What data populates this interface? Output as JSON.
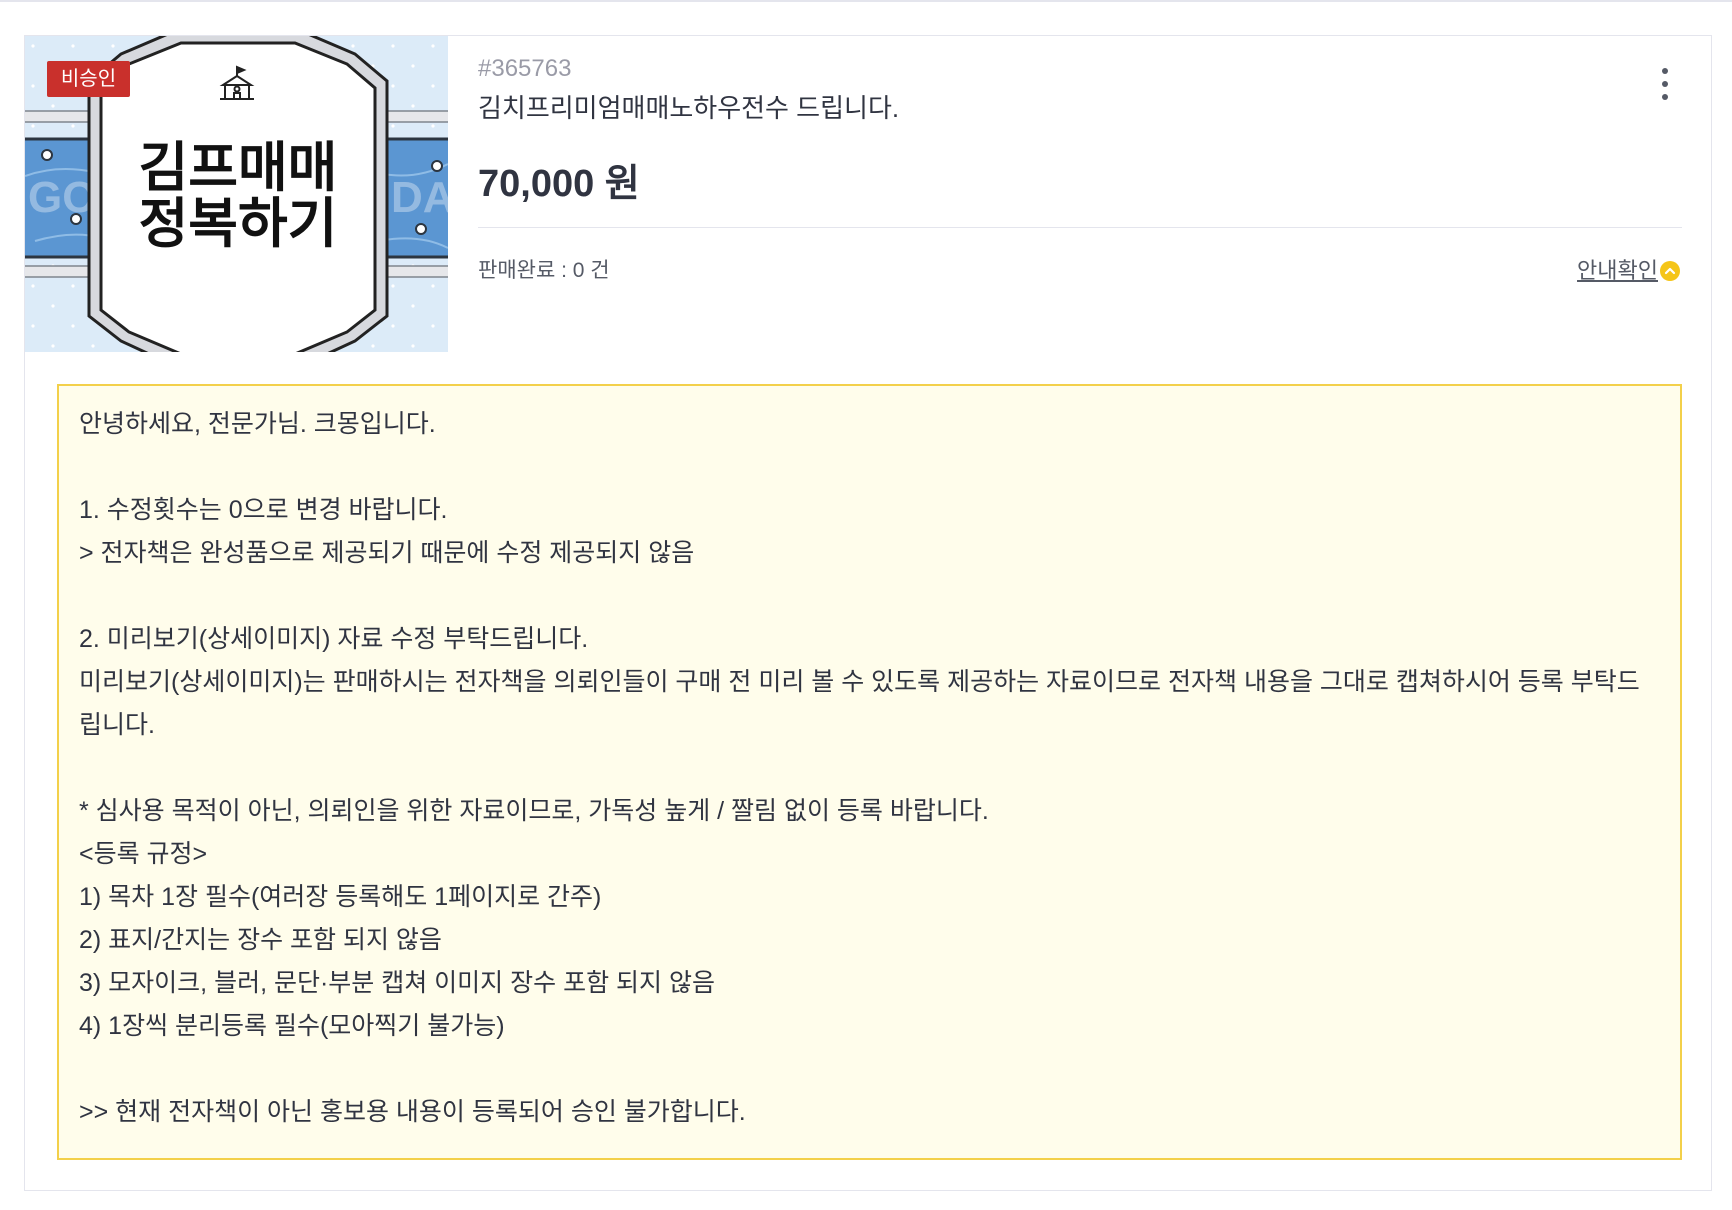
{
  "status_badge": "비승인",
  "thumbnail": {
    "headline_line1": "김프매매",
    "headline_line2": "정복하기",
    "bg_text_left": "GO",
    "bg_text_right": "DA",
    "icon": "school-icon",
    "colors": {
      "background": "#dcebf8",
      "band": "#5b96d2",
      "frame": "#d7d9de"
    }
  },
  "service": {
    "id": "#365763",
    "title": "김치프리미엄매매노하우전수 드립니다.",
    "price": "70,000 원",
    "sales_count": "판매완료 : 0 건",
    "guide_link": "안내확인",
    "guide_icon": "chevron-up-icon",
    "menu_icon": "more-vertical-icon"
  },
  "notice": {
    "paragraphs": [
      [
        "안녕하세요, 전문가님. 크몽입니다."
      ],
      [
        "1. 수정횟수는 0으로 변경 바랍니다.",
        "> 전자책은 완성품으로 제공되기 때문에 수정 제공되지 않음"
      ],
      [
        "2. 미리보기(상세이미지) 자료 수정 부탁드립니다.",
        "미리보기(상세이미지)는 판매하시는 전자책을 의뢰인들이 구매 전 미리 볼 수 있도록 제공하는 자료이므로 전자책 내용을 그대로 캡쳐하시어 등록 부탁드립니다."
      ],
      [
        "* 심사용 목적이 아닌, 의뢰인을 위한 자료이므로, 가독성 높게 / 짤림 없이 등록 바랍니다.",
        "<등록 규정>",
        "1) 목차 1장 필수(여러장 등록해도 1페이지로 간주)",
        "2) 표지/간지는 장수 포함 되지 않음",
        "3) 모자이크, 블러, 문단·부분 캡쳐 이미지 장수 포함 되지 않음",
        "4) 1장씩 분리등록 필수(모아찍기 불가능)"
      ],
      [
        ">> 현재 전자책이 아닌 홍보용 내용이 등록되어 승인 불가합니다."
      ]
    ]
  },
  "colors": {
    "badge": "#c9302c",
    "notice_background": "#fffdeb",
    "notice_border": "#f3d04a",
    "text": "#303441",
    "muted": "#9a9ba7",
    "guide_icon": "#f5c518"
  }
}
